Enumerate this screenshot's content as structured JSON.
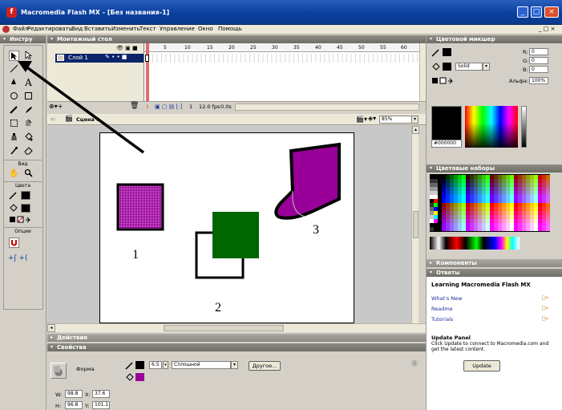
{
  "window": {
    "title": "Macromedia Flash MX - [Без названия-1]",
    "app_icon": "f",
    "min": "_",
    "max": "□",
    "close": "×"
  },
  "menu": [
    "Файл",
    "Редактировать",
    "Вид",
    "Вставить",
    "Изменить",
    "Текст",
    "Управление",
    "Окно",
    "Помощь"
  ],
  "menu_right": "_ □ ×",
  "toolbox": {
    "title": "Инстру",
    "tools_text_a": "A",
    "view_label": "Вид",
    "colors_label": "Цвета",
    "options_label": "Опции"
  },
  "timeline": {
    "title": "Монтажный стол",
    "layer_name": "Слой 1",
    "ticks": [
      "5",
      "10",
      "15",
      "20",
      "25",
      "30",
      "35",
      "40",
      "45",
      "50",
      "55",
      "60"
    ],
    "frame": "1",
    "fps": "12.0 fps",
    "time": "0.0s"
  },
  "scene": {
    "label": "Сцена 1",
    "zoom": "85%"
  },
  "stage": {
    "labels": [
      "1",
      "2",
      "3"
    ],
    "fill_purple": "#990099",
    "fill_green": "#006600"
  },
  "color_mixer": {
    "title": "Цветовой микшер",
    "fill_type": "Solid",
    "r_label": "R:",
    "r": "0",
    "g_label": "G:",
    "g": "0",
    "b_label": "B:",
    "b": "0",
    "alpha_label": "Альфа:",
    "alpha": "100%",
    "hex": "#000000"
  },
  "swatches": {
    "title": "Цветовые наборы"
  },
  "components": {
    "title": "Компоненты"
  },
  "answers": {
    "title": "Ответы",
    "heading": "Learning Macromedia Flash MX",
    "links": [
      "What's New",
      "Readme",
      "Tutorials"
    ],
    "update_title": "Update Panel",
    "update_text": "Click Update to connect to Macromedia.com and get the latest content.",
    "update_button": "Update"
  },
  "actions": {
    "title": "Действия"
  },
  "properties": {
    "title": "Свойства",
    "shape_label": "Форма",
    "stroke_size": "6.5",
    "stroke_style": "Сплошной",
    "custom_button": "Другое...",
    "w_label": "W:",
    "w": "98.8",
    "x_label": "X:",
    "x": "37.6",
    "h_label": "H:",
    "h": "96.8",
    "y_label": "Y:",
    "y": "101.1"
  }
}
